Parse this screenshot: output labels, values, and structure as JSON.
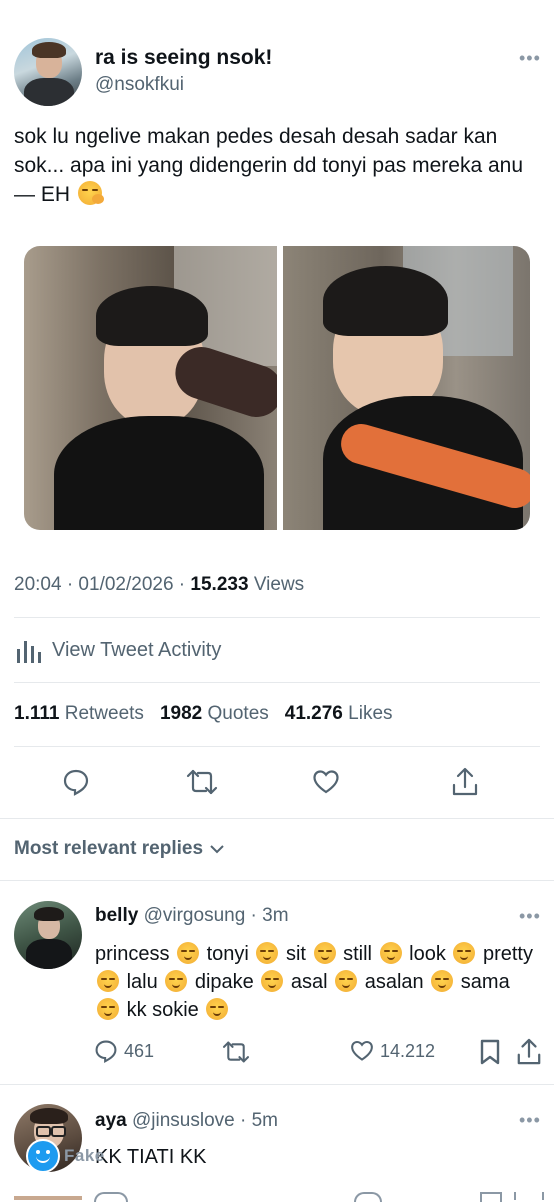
{
  "tweet": {
    "author_name": "ra is seeing nsok!",
    "author_handle": "@nsokfkui",
    "text": "sok lu ngelive makan pedes desah desah sadar kan sok... apa ini yang didengerin dd tonyi pas mereka anu— EH",
    "text_emoji": "face-with-hand-over-mouth",
    "time": "20:04 · 01/02/2026 · ",
    "views_count": "15.233",
    "views_label": " Views",
    "activity_label": "View Tweet Activity",
    "stats": {
      "retweets_count": "1.111",
      "retweets_label": "Retweets",
      "quotes_count": "1982",
      "quotes_label": "Quotes",
      "likes_count": "41.276",
      "likes_label": "Likes"
    }
  },
  "replies_header": "Most relevant replies",
  "replies": [
    {
      "name": "belly",
      "handle": "@virgosung · 3m",
      "words": [
        "princess",
        "tonyi",
        "sit",
        "still",
        "look",
        "pretty",
        "lalu",
        "dipake",
        "asal",
        "asalan",
        "sama",
        "kk sokie"
      ],
      "emoji": "relieved-face",
      "reply_count": "461",
      "like_count": "14.212"
    },
    {
      "name": "aya",
      "handle": "@jinsuslove · 5m",
      "text": "KK TIATI KK",
      "badge": "Fake"
    }
  ],
  "colors": {
    "accent": "#1d9bf0",
    "muted": "#536471",
    "divider": "#e6e9ec"
  }
}
